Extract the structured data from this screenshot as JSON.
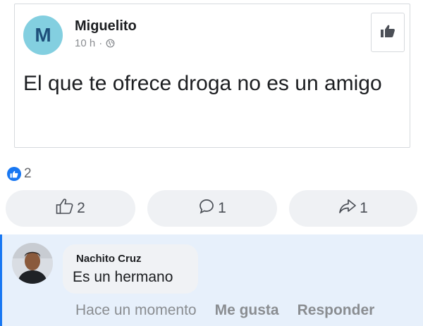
{
  "post": {
    "avatar_letter": "M",
    "author": "Miguelito",
    "time": "10 h",
    "separator": "·",
    "privacy_icon": "globe-icon",
    "text": "El que te ofrece droga no es un amigo"
  },
  "reactions": {
    "count": "2",
    "icon": "like-badge-icon"
  },
  "actions": {
    "like_count": "2",
    "comment_count": "1",
    "share_count": "1"
  },
  "comment": {
    "author": "Nachito Cruz",
    "text": "Es un hermano",
    "time": "Hace un momento",
    "like_label": "Me gusta",
    "reply_label": "Responder"
  },
  "colors": {
    "accent": "#1877f2",
    "avatar_m_bg": "#83cfe0",
    "comment_highlight_bg": "#e7f0fb",
    "pill_bg": "#eff1f4",
    "muted_text": "#8a8d91"
  }
}
